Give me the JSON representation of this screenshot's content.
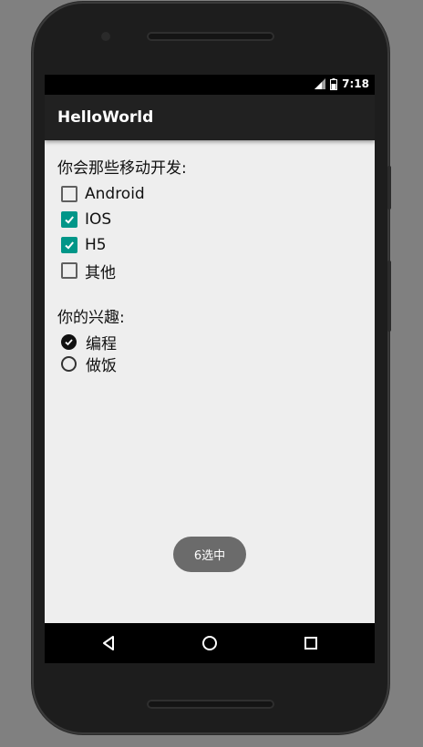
{
  "status_bar": {
    "time": "7:18",
    "icons": [
      "signal-icon",
      "battery-icon"
    ]
  },
  "app_bar": {
    "title": "HelloWorld"
  },
  "question_mobile": {
    "label": "你会那些移动开发:",
    "options": [
      {
        "label": "Android",
        "checked": false
      },
      {
        "label": "IOS",
        "checked": true
      },
      {
        "label": "H5",
        "checked": true
      },
      {
        "label": "其他",
        "checked": false
      }
    ]
  },
  "question_interest": {
    "label": "你的兴趣:",
    "options": [
      {
        "label": "编程",
        "selected": true
      },
      {
        "label": "做饭",
        "selected": false
      }
    ]
  },
  "toast": {
    "text": "6选中"
  },
  "nav_bar": {
    "buttons": [
      "back-icon",
      "home-icon",
      "recents-icon"
    ]
  },
  "colors": {
    "accent": "#009688",
    "app_bar": "#212121",
    "background": "#eeeeee",
    "toast": "#6b6b6b"
  }
}
